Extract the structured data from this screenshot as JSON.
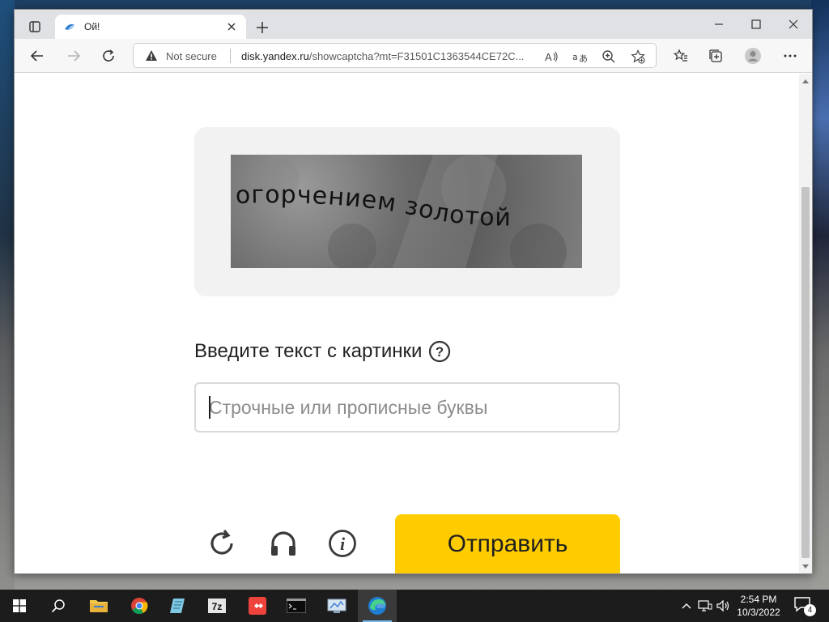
{
  "browser": {
    "tab_title": "Ой!",
    "address": {
      "security_label": "Not secure",
      "url_host": "disk.yandex.ru",
      "url_rest": "/showcaptcha?mt=F31501C1363544CE72C..."
    },
    "toolbar_icons": [
      "back-icon",
      "forward-icon",
      "refresh-icon",
      "read-aloud-icon",
      "translate-icon",
      "zoom-icon",
      "add-favorite-icon",
      "favorites-icon",
      "collections-icon",
      "profile-icon",
      "more-icon"
    ]
  },
  "captcha": {
    "image_text": "огорчением золотой",
    "prompt_label": "Введите текст с картинки",
    "input_placeholder": "Строчные или прописные буквы",
    "input_value": "",
    "submit_label": "Отправить",
    "action_icons": [
      "refresh-captcha-icon",
      "audio-captcha-icon",
      "info-icon"
    ]
  },
  "taskbar": {
    "apps": [
      "start-icon",
      "search-icon",
      "file-explorer-icon",
      "chrome-icon",
      "notepad-icon",
      "7zip-icon",
      "anydesk-icon",
      "terminal-icon",
      "control-panel-icon",
      "edge-icon"
    ],
    "active_app": "edge-icon",
    "clock_time": "2:54 PM",
    "clock_date": "10/3/2022",
    "notification_count": "4"
  },
  "colors": {
    "submit": "#ffcc00",
    "captcha_bg": "#f2f2f2",
    "taskbar": "#1c1c1c"
  }
}
